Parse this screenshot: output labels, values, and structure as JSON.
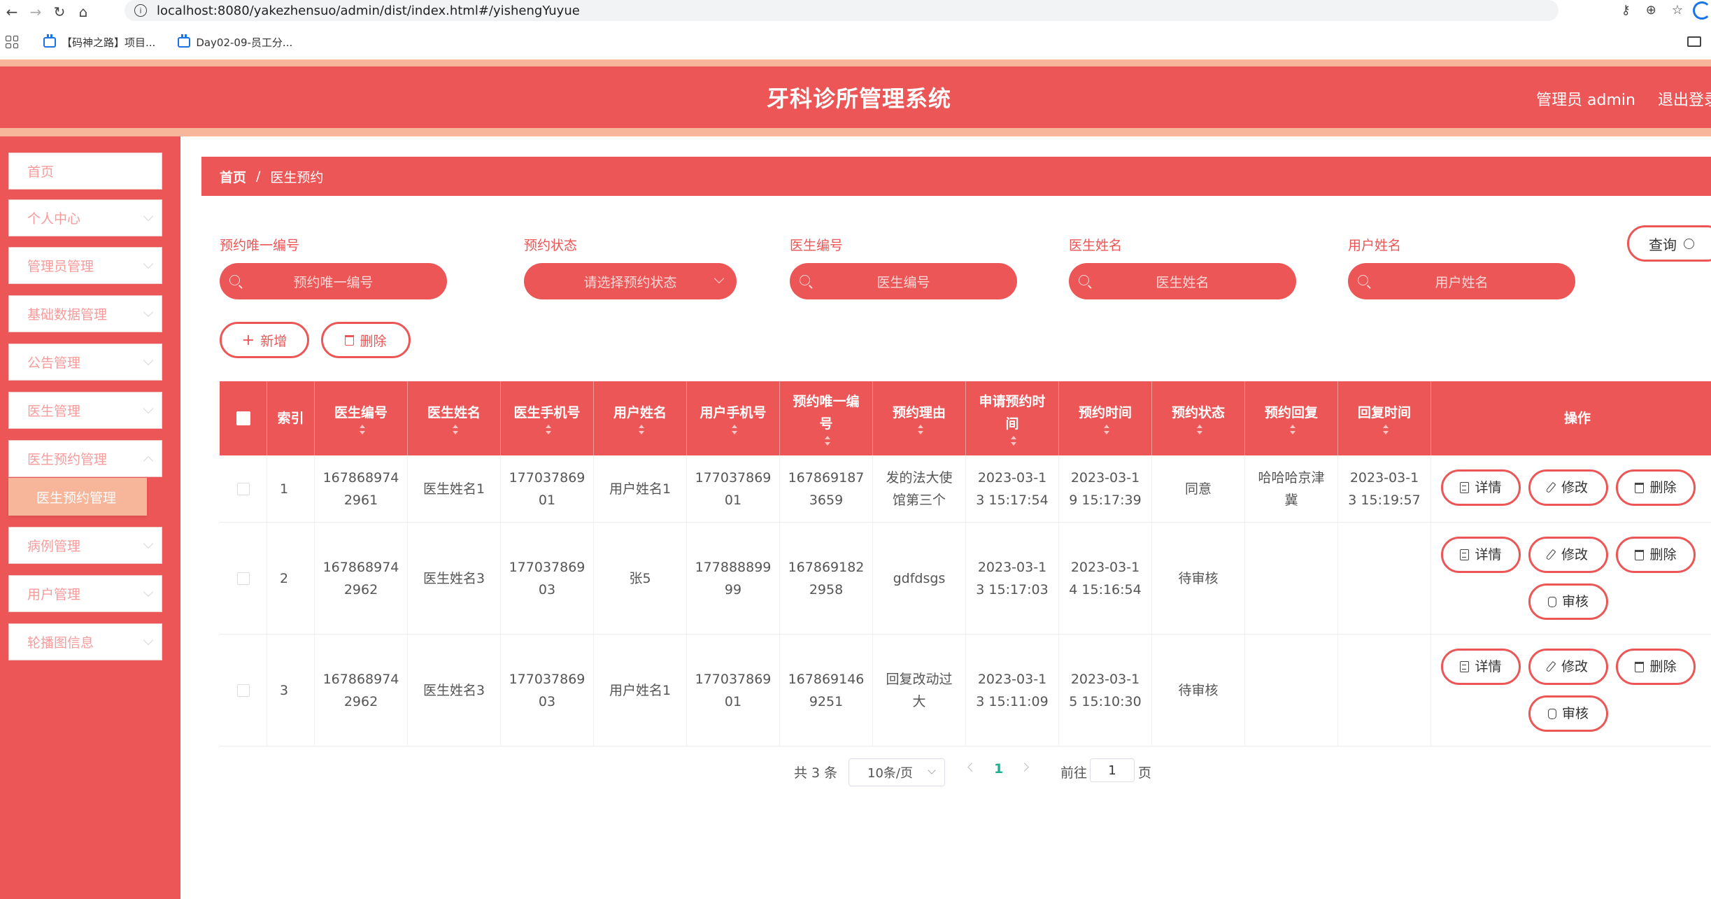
{
  "browser": {
    "url": "localhost:8080/yakezhensuo/admin/dist/index.html#/yishengYuyue",
    "bookmarks": [
      "【码神之路】项目...",
      "Day02-09-员工分..."
    ]
  },
  "header": {
    "title": "牙科诊所管理系统",
    "user": "管理员 admin",
    "logout": "退出登录"
  },
  "sidebar": {
    "items": [
      {
        "label": "首页"
      },
      {
        "label": "个人中心"
      },
      {
        "label": "管理员管理"
      },
      {
        "label": "基础数据管理"
      },
      {
        "label": "公告管理"
      },
      {
        "label": "医生管理"
      },
      {
        "label": "医生预约管理"
      },
      {
        "label": "病例管理"
      },
      {
        "label": "用户管理"
      },
      {
        "label": "轮播图信息"
      }
    ],
    "active_sub": "医生预约管理"
  },
  "breadcrumb": {
    "home": "首页",
    "sep": "/",
    "current": "医生预约"
  },
  "search": {
    "labels": [
      "预约唯一编号",
      "预约状态",
      "医生编号",
      "医生姓名",
      "用户姓名"
    ],
    "placeholders": [
      "预约唯一编号",
      "请选择预约状态",
      "医生编号",
      "医生姓名",
      "用户姓名"
    ],
    "query_button": "查询"
  },
  "actions": {
    "add": "新增",
    "delete": "删除"
  },
  "table": {
    "headers": [
      "索引",
      "医生编号",
      "医生姓名",
      "医生手机号",
      "用户姓名",
      "用户手机号",
      "预约唯一编号",
      "预约理由",
      "申请预约时间",
      "预约时间",
      "预约状态",
      "预约回复",
      "回复时间",
      "操作"
    ],
    "rows": [
      {
        "index": "1",
        "doctor_no": [
          "167868974",
          "2961"
        ],
        "doctor_name": "医生姓名1",
        "doctor_phone": [
          "177037869",
          "01"
        ],
        "user_name": "用户姓名1",
        "user_phone": [
          "177037869",
          "01"
        ],
        "booking_no": [
          "167869187",
          "3659"
        ],
        "reason": [
          "发的法大使",
          "馆第三个"
        ],
        "apply_time": [
          "2023-03-1",
          "3 15:17:54"
        ],
        "booking_time": [
          "2023-03-1",
          "9 15:17:39"
        ],
        "status": "同意",
        "reply": [
          "哈哈哈京津",
          "冀"
        ],
        "reply_time": [
          "2023-03-1",
          "3 15:19:57"
        ]
      },
      {
        "index": "2",
        "doctor_no": [
          "167868974",
          "2962"
        ],
        "doctor_name": "医生姓名3",
        "doctor_phone": [
          "177037869",
          "03"
        ],
        "user_name": "张5",
        "user_phone": [
          "177888899",
          "99"
        ],
        "booking_no": [
          "167869182",
          "2958"
        ],
        "reason": [
          "gdfdsgs",
          ""
        ],
        "apply_time": [
          "2023-03-1",
          "3 15:17:03"
        ],
        "booking_time": [
          "2023-03-1",
          "4 15:16:54"
        ],
        "status": "待审核",
        "reply": [
          "",
          ""
        ],
        "reply_time": [
          "",
          ""
        ]
      },
      {
        "index": "3",
        "doctor_no": [
          "167868974",
          "2962"
        ],
        "doctor_name": "医生姓名3",
        "doctor_phone": [
          "177037869",
          "03"
        ],
        "user_name": "用户姓名1",
        "user_phone": [
          "177037869",
          "01"
        ],
        "booking_no": [
          "167869146",
          "9251"
        ],
        "reason": [
          "回复改动过",
          "大"
        ],
        "apply_time": [
          "2023-03-1",
          "3 15:11:09"
        ],
        "booking_time": [
          "2023-03-1",
          "5 15:10:30"
        ],
        "status": "待审核",
        "reply": [
          "",
          ""
        ],
        "reply_time": [
          "",
          ""
        ]
      }
    ],
    "row_buttons": {
      "detail": "详情",
      "edit": "修改",
      "delete": "删除",
      "review": "审核"
    }
  },
  "pagination": {
    "total": "共 3 条",
    "page_size": "10条/页",
    "current": "1",
    "goto_prefix": "前往",
    "goto_value": "1",
    "goto_suffix": "页"
  },
  "colors": {
    "primary": "#ec5656",
    "accent_light": "#f7b59a",
    "active_page": "#1fb090"
  }
}
